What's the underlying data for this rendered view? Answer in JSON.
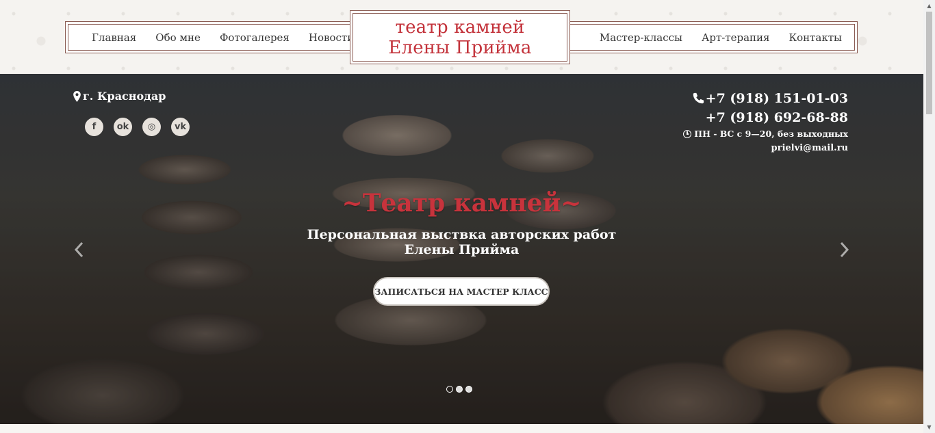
{
  "header": {
    "nav_left": [
      "Главная",
      "Обо мне",
      "Фотогалерея",
      "Новости"
    ],
    "nav_right": [
      "Мастер-классы",
      "Арт-терапия",
      "Контакты"
    ],
    "logo_line1": "театр камней",
    "logo_line2": "Елены Прийма"
  },
  "hero": {
    "city": "г. Краснодар",
    "socials": [
      {
        "icon": "facebook-icon",
        "glyph": "f"
      },
      {
        "icon": "odnoklassniki-icon",
        "glyph": "ok"
      },
      {
        "icon": "instagram-icon",
        "glyph": "◎"
      },
      {
        "icon": "vk-icon",
        "glyph": "vk"
      }
    ],
    "phone1": "+7 (918) 151-01-03",
    "phone2": "+7 (918) 692-68-88",
    "hours": "ПН - ВС с 9—20, без выходных",
    "email": "prielvi@mail.ru",
    "title": "~Театр камней~",
    "subtitle_line1": "Персональная выствка авторских работ",
    "subtitle_line2": "Елены Прийма",
    "cta": "ЗАПИСАТЬСЯ НА МАСТЕР КЛАСС",
    "slides": 3,
    "active_slide": 0
  },
  "colors": {
    "brand_red": "#c3323a",
    "frame_brown": "#8a5b52"
  }
}
